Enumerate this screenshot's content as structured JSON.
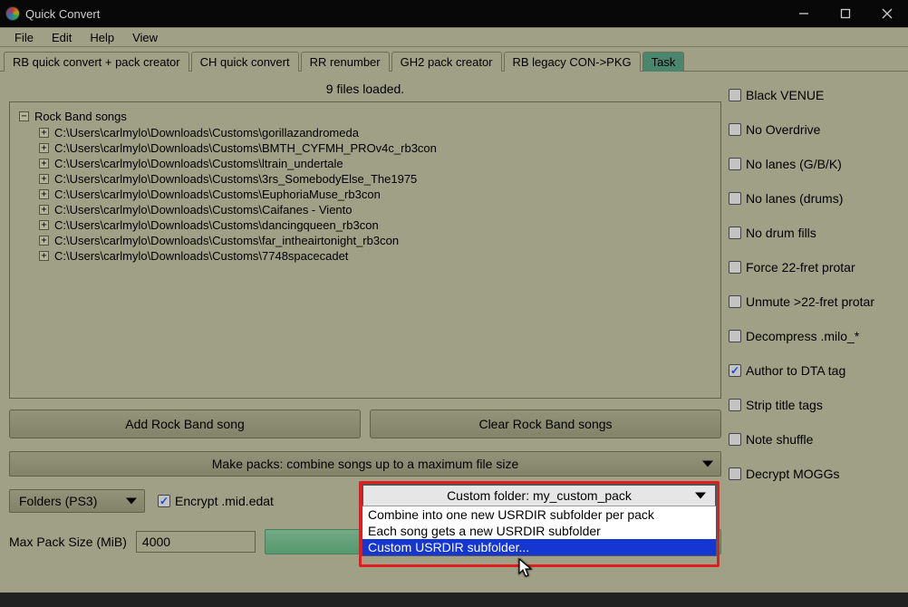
{
  "window": {
    "title": "Quick Convert"
  },
  "menu": {
    "file": "File",
    "edit": "Edit",
    "help": "Help",
    "view": "View"
  },
  "tabs": [
    {
      "label": "RB quick convert + pack creator",
      "active": true
    },
    {
      "label": "CH quick convert",
      "active": false
    },
    {
      "label": "RR renumber",
      "active": false
    },
    {
      "label": "GH2 pack creator",
      "active": false
    },
    {
      "label": "RB legacy CON->PKG",
      "active": false
    },
    {
      "label": "Task",
      "active": false,
      "kind": "task"
    }
  ],
  "status": "9 files loaded.",
  "tree": {
    "root": "Rock Band songs",
    "items": [
      "C:\\Users\\carlmylo\\Downloads\\Customs\\gorillazandromeda",
      "C:\\Users\\carlmylo\\Downloads\\Customs\\BMTH_CYFMH_PROv4c_rb3con",
      "C:\\Users\\carlmylo\\Downloads\\Customs\\ltrain_undertale",
      "C:\\Users\\carlmylo\\Downloads\\Customs\\3rs_SomebodyElse_The1975",
      "C:\\Users\\carlmylo\\Downloads\\Customs\\EuphoriaMuse_rb3con",
      "C:\\Users\\carlmylo\\Downloads\\Customs\\Caifanes - Viento",
      "C:\\Users\\carlmylo\\Downloads\\Customs\\dancingqueen_rb3con",
      "C:\\Users\\carlmylo\\Downloads\\Customs\\far_intheairtonight_rb3con",
      "C:\\Users\\carlmylo\\Downloads\\Customs\\7748spacecadet"
    ]
  },
  "buttons": {
    "add": "Add Rock Band song",
    "clear": "Clear Rock Band songs"
  },
  "dropdowns": {
    "pack_mode": "Make packs: combine songs up to a maximum file size",
    "output_kind": "Folders (PS3)",
    "custom_folder": "Custom folder: my_custom_pack",
    "options": [
      "Combine into one new USRDIR subfolder per pack",
      "Each song gets a new USRDIR subfolder",
      "Custom USRDIR subfolder..."
    ]
  },
  "checkboxes": {
    "encrypt": {
      "label": "Encrypt .mid.edat",
      "checked": true
    }
  },
  "maxpack": {
    "label": "Max Pack Size (MiB)",
    "value": "4000"
  },
  "right_options": [
    {
      "label": "Black VENUE",
      "checked": false
    },
    {
      "label": "No Overdrive",
      "checked": false
    },
    {
      "label": "No lanes (G/B/K)",
      "checked": false
    },
    {
      "label": "No lanes (drums)",
      "checked": false
    },
    {
      "label": "No drum fills",
      "checked": false
    },
    {
      "label": "Force 22-fret protar",
      "checked": false
    },
    {
      "label": "Unmute >22-fret protar",
      "checked": false
    },
    {
      "label": "Decompress .milo_*",
      "checked": false
    },
    {
      "label": "Author to DTA tag",
      "checked": true
    },
    {
      "label": "Strip title tags",
      "checked": false
    },
    {
      "label": "Note shuffle",
      "checked": false
    },
    {
      "label": "Decrypt MOGGs",
      "checked": false
    }
  ]
}
